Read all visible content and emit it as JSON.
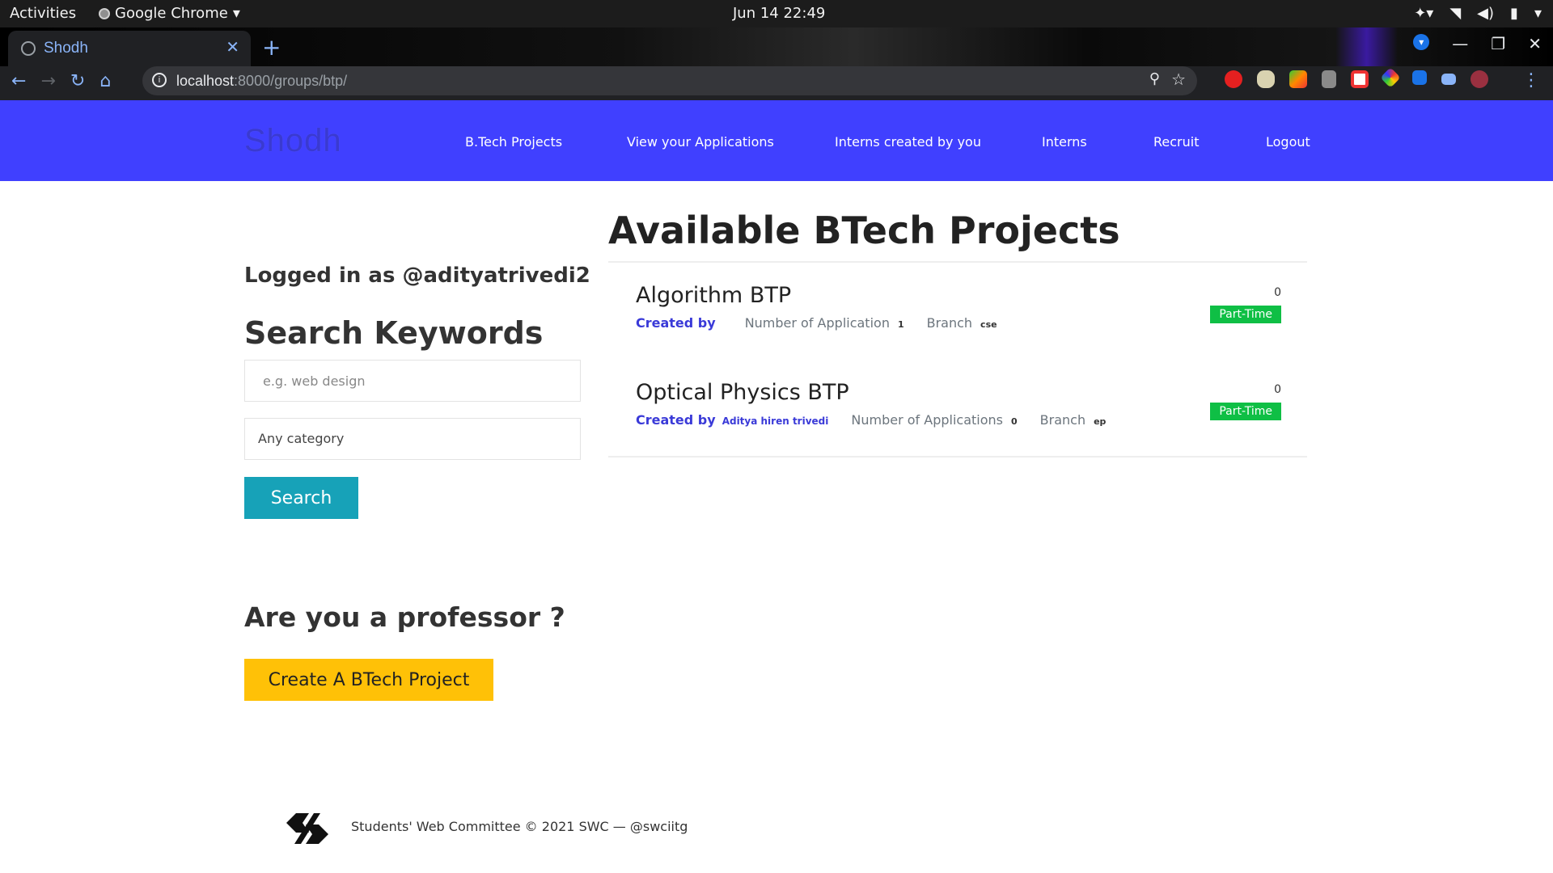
{
  "os": {
    "activities": "Activities",
    "app_name": "Google Chrome",
    "clock": "Jun 14  22:49"
  },
  "browser": {
    "tab_title": "Shodh",
    "url_host": "localhost",
    "url_path": ":8000/groups/btp/"
  },
  "site": {
    "brand": "Shodh",
    "nav": [
      "B.Tech Projects",
      "View your Applications",
      "Interns created by you",
      "Interns",
      "Recruit",
      "Logout"
    ]
  },
  "sidebar": {
    "logged_in": "Logged in as @adityatrivedi2",
    "search_title": "Search Keywords",
    "keyword_placeholder": "e.g. web design",
    "category_value": "Any category",
    "search_button": "Search",
    "professor_title": "Are you a professor ?",
    "create_button": "Create A BTech Project"
  },
  "main": {
    "title": "Available BTech Projects",
    "projects": [
      {
        "title": "Algorithm BTP",
        "created_by_label": "Created by",
        "creator": "",
        "applications_label": "Number of Application",
        "applications": "1",
        "branch_label": "Branch",
        "branch": "cse",
        "count": "0",
        "type": "Part-Time"
      },
      {
        "title": "Optical Physics BTP",
        "created_by_label": "Created by",
        "creator": "Aditya hiren trivedi",
        "applications_label": "Number of Applications",
        "applications": "0",
        "branch_label": "Branch",
        "branch": "ep",
        "count": "0",
        "type": "Part-Time"
      }
    ]
  },
  "footer": {
    "text": "Students' Web Committee © 2021 SWC —   @swciitg"
  },
  "colors": {
    "nav_bg": "#4040ff",
    "search_btn": "#17a2b8",
    "create_btn": "#ffc107",
    "badge": "#0fbf45",
    "link": "#3a3ad8"
  }
}
